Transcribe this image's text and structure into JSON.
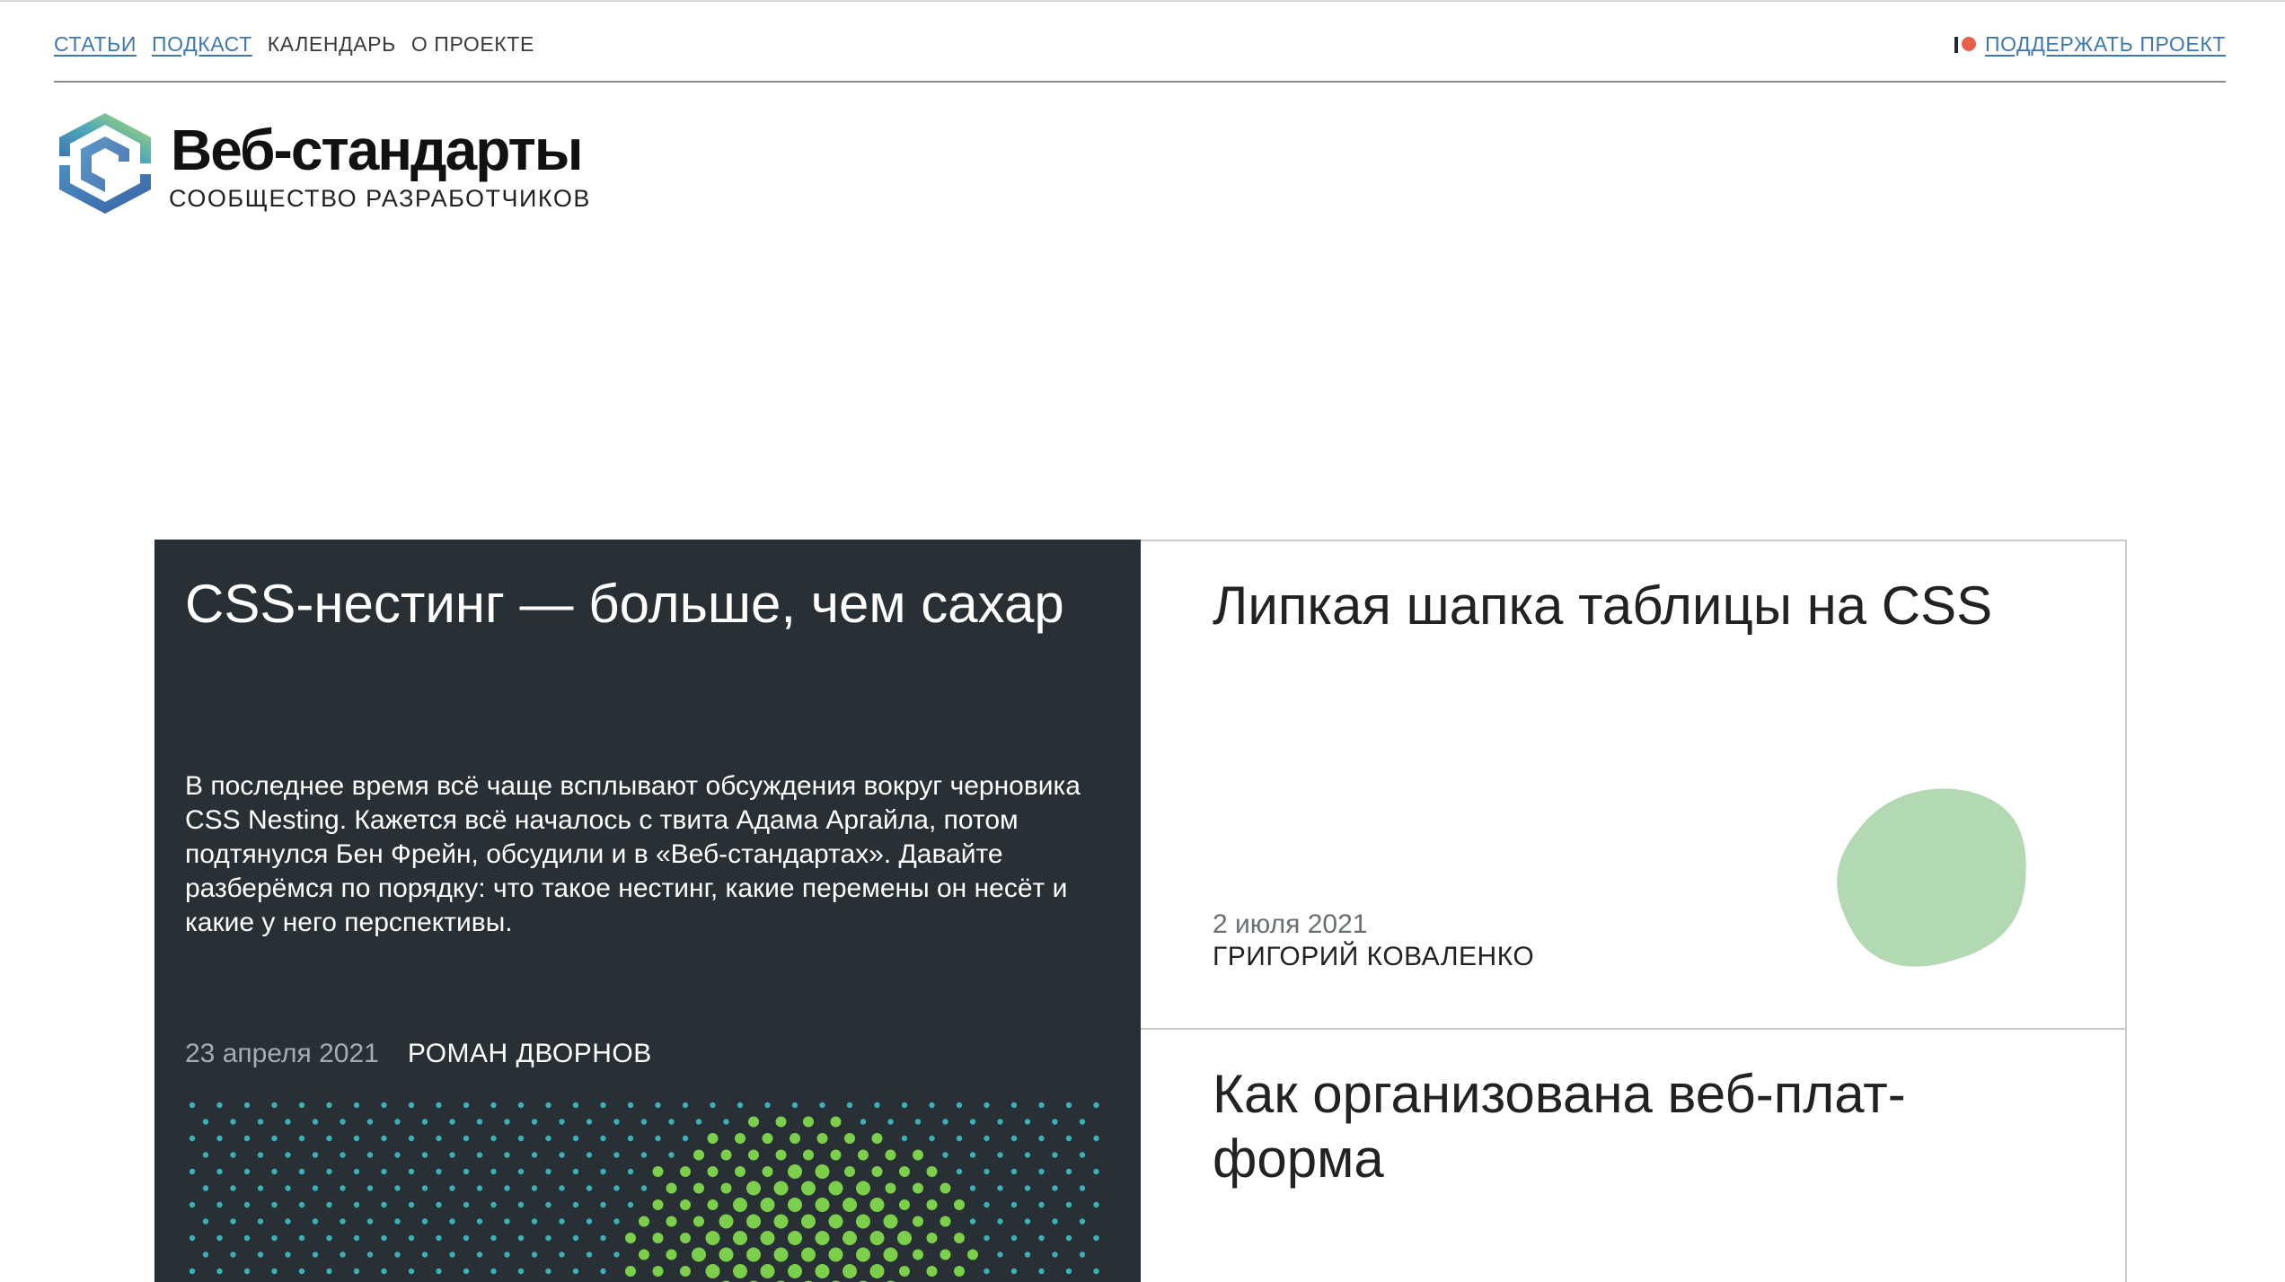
{
  "nav": {
    "items": [
      {
        "label": "СТАТЬИ",
        "link": true
      },
      {
        "label": "ПОДКАСТ",
        "link": true
      },
      {
        "label": "КАЛЕНДАРЬ",
        "link": false
      },
      {
        "label": "О ПРОЕКТЕ",
        "link": false
      }
    ],
    "support_label": "ПОДДЕРЖАТЬ ПРОЕКТ",
    "support_icon": "patreon-icon"
  },
  "brand": {
    "title": "Веб-стандарты",
    "subtitle": "СООБЩЕСТВО РАЗРАБОТЧИКОВ",
    "logo_icon": "cube-logo-icon"
  },
  "articles": [
    {
      "title": "CSS-нестинг — больше, чем са­хар",
      "excerpt": "В последнее время всё чаще всплывают обсуждения вокруг черновика CSS Nesting. Кажется всё началось с твита Адама Аргайла, потом подтянулся Бен Фрейн, обсудили и в «Веб-стандартах». Давайте разберёмся по порядку: что такое нестинг, какие перемены он несёт и какие у него перспективы.",
      "date": "23 апреля 2021",
      "author": "РОМАН ДВОРНОВ"
    },
    {
      "title": "Липкая шапка таблицы на CSS",
      "date": "2 июля 2021",
      "author": "ГРИГОРИЙ КОВАЛЕНКО"
    },
    {
      "title": "Как организована веб-плат­форма"
    }
  ],
  "colors": {
    "link": "#3d78b1",
    "dark_card": "#283035",
    "blob_green": "#b2d9b2",
    "blob_teal": "#8ecfd0",
    "dot_teal": "#3ab0b8",
    "dot_green": "#7ccf4a",
    "patreon_dot": "#e8604c"
  }
}
